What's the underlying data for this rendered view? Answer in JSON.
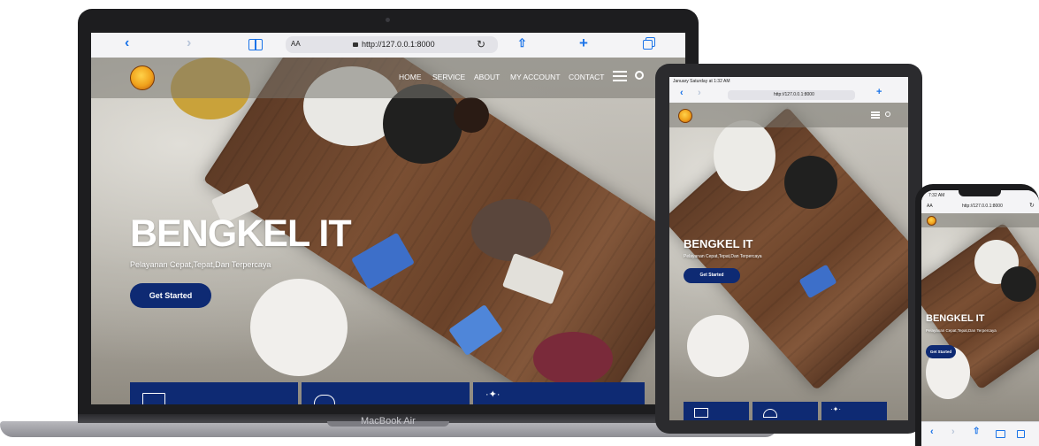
{
  "browser": {
    "url": "http://127.0.0.1:8000",
    "reader_label": "AA",
    "back_icon": "chevron-left-icon",
    "forward_icon": "chevron-right-icon",
    "bookmarks_icon": "book-icon",
    "reload_icon": "reload-icon",
    "share_icon": "share-icon",
    "new_tab_icon": "plus-icon",
    "tabs_icon": "tabs-icon"
  },
  "site": {
    "nav": [
      "HOME",
      "SERVICE",
      "ABOUT",
      "MY ACCOUNT",
      "CONTACT"
    ],
    "hero_title": "BENGKEL IT",
    "hero_subtitle": "Pelayanan Cepat,Tepat,Dan Terpercaya",
    "cta_label": "Get Started"
  },
  "devices": {
    "laptop_label": "MacBook Air",
    "tablet_status": "January Saturday at 1:32 AM",
    "phone_time": "7:32 AM"
  },
  "colors": {
    "brand_navy": "#0e2a73",
    "safari_accent": "#1a73e8",
    "device_frame": "#2b2b2e",
    "laptop_base": "#9a9aa0"
  }
}
